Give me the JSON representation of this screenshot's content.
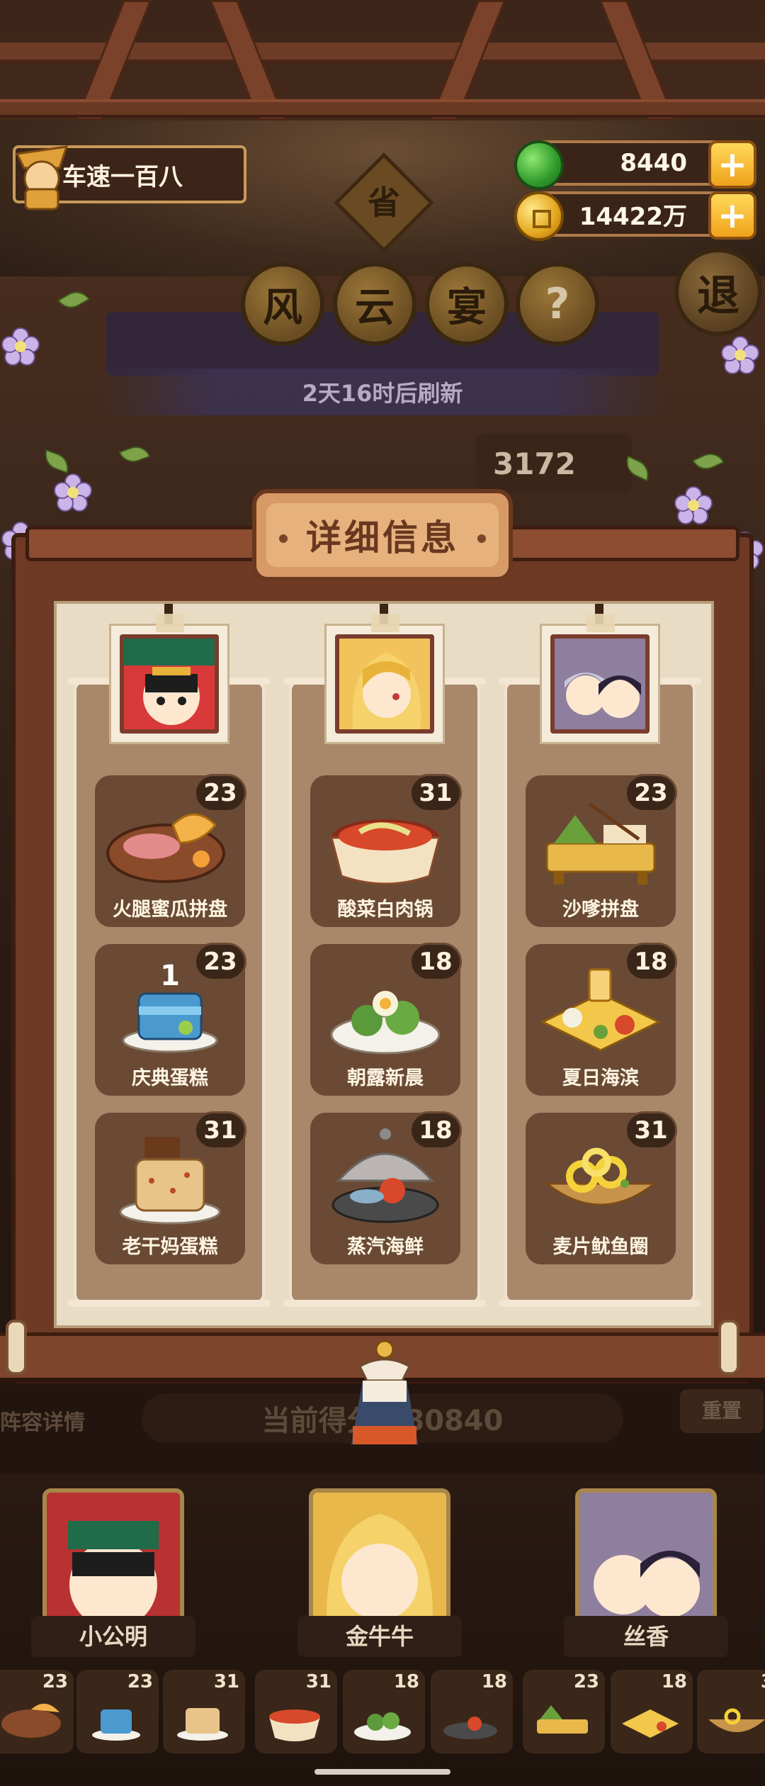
{
  "player": {
    "name": "车速一百八"
  },
  "currencies": {
    "gems": {
      "amount": "8440",
      "add_label": "+"
    },
    "coins": {
      "amount": "14422万",
      "add_label": "+"
    }
  },
  "header": {
    "province_badge": "省",
    "event_chars": [
      "风",
      "云",
      "宴"
    ],
    "help_label": "?",
    "exit_label": "退",
    "refresh_text": "2天16时后刷新",
    "partial_score": "3172"
  },
  "modal": {
    "title": "详细信息",
    "columns": [
      {
        "dishes": [
          {
            "name": "火腿蜜瓜拼盘",
            "count": "23"
          },
          {
            "name": "庆典蛋糕",
            "count": "23"
          },
          {
            "name": "老干妈蛋糕",
            "count": "31"
          }
        ]
      },
      {
        "dishes": [
          {
            "name": "酸菜白肉锅",
            "count": "31"
          },
          {
            "name": "朝露新晨",
            "count": "18"
          },
          {
            "name": "蒸汽海鲜",
            "count": "18"
          }
        ]
      },
      {
        "dishes": [
          {
            "name": "沙嗲拼盘",
            "count": "23"
          },
          {
            "name": "夏日海滨",
            "count": "18"
          },
          {
            "name": "麦片鱿鱼圈",
            "count": "31"
          }
        ]
      }
    ]
  },
  "behind": {
    "lineup_label": "阵容详情",
    "score_text": "当前得分 980840",
    "reset_label": "重置",
    "heroes": [
      {
        "name": "小公明"
      },
      {
        "name": "金牛牛"
      },
      {
        "name": "丝香"
      }
    ],
    "mini_counts": [
      "23",
      "23",
      "31",
      "31",
      "18",
      "18",
      "23",
      "18",
      "3"
    ]
  },
  "colors": {
    "accent_gold": "#f0a21c",
    "frame_brown": "#6e3a25",
    "paper": "#e9dcc5",
    "card_brown": "#6a4a34"
  }
}
